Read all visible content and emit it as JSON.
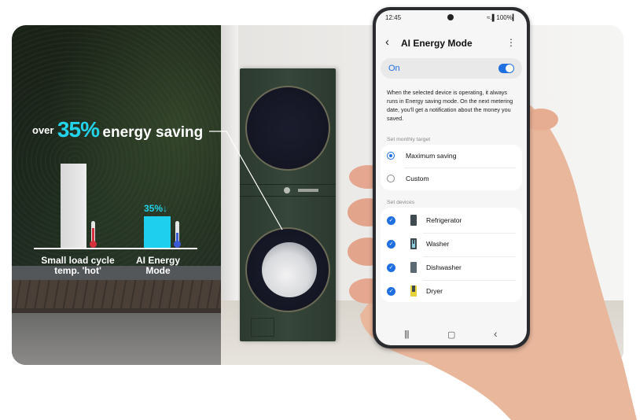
{
  "promo": {
    "headline_prefix": "over",
    "headline_percent": "35%",
    "headline_suffix": "energy saving"
  },
  "comparison": {
    "bar_hot_label_line1": "Small load cycle",
    "bar_hot_label_line2": "temp. 'hot'",
    "bar_ai_label": "AI Energy Mode",
    "bar_ai_value": "35%↓",
    "ai_relative_height": 0.37,
    "accent": "#22d3ea"
  },
  "phone": {
    "status_time": "12:45",
    "status_icons": "≈.▌100%▎",
    "app_title": "AI Energy Mode",
    "back_icon": "‹",
    "menu_icon": "⋮",
    "toggle_label": "On",
    "toggle_on": true,
    "description": "When the selected device is operating, it always runs in Energy saving mode. On the next metering date, you'll get a notification about the money you saved.",
    "monthly_target_header": "Set monthly target",
    "targets": [
      {
        "label": "Maximum saving",
        "selected": true
      },
      {
        "label": "Custom",
        "selected": false
      }
    ],
    "devices_header": "Set devices",
    "devices": [
      {
        "label": "Refrigerator",
        "checked": true,
        "icon": "refrigerator-icon"
      },
      {
        "label": "Washer",
        "checked": true,
        "icon": "washer-icon"
      },
      {
        "label": "Dishwasher",
        "checked": true,
        "icon": "dishwasher-icon"
      },
      {
        "label": "Dryer",
        "checked": true,
        "icon": "dryer-icon"
      }
    ],
    "nav": {
      "recents": "|||",
      "home": "▢",
      "back": "‹"
    },
    "accent": "#1f6fe0"
  }
}
